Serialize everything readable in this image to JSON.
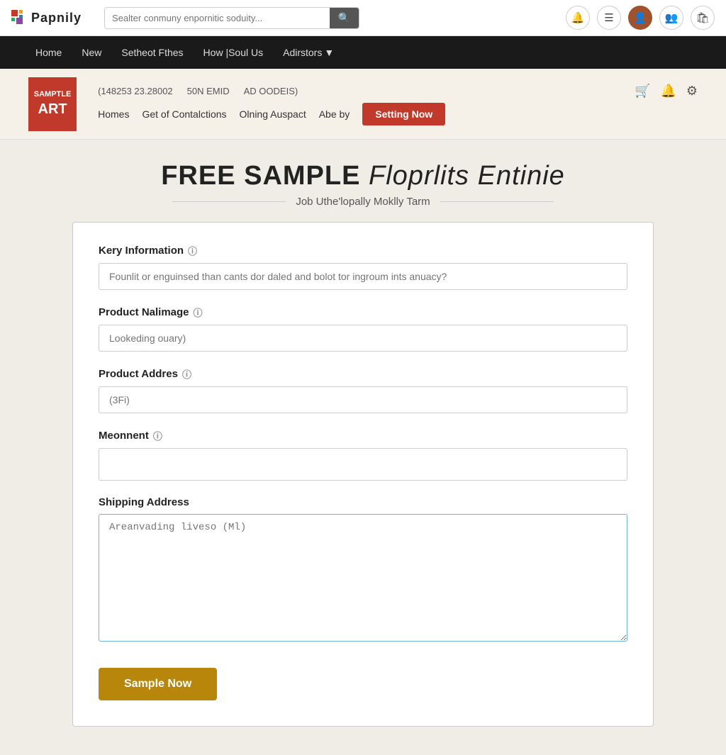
{
  "topbar": {
    "logo_text": "Papnily",
    "search_placeholder": "Sealter conmuny enpornitic soduity...",
    "search_value": ""
  },
  "main_nav": {
    "items": [
      {
        "label": "Home"
      },
      {
        "label": "New"
      },
      {
        "label": "Setheot Fthes"
      },
      {
        "label": "How |Soul Us"
      },
      {
        "label": "Adirstors",
        "dropdown": true
      }
    ]
  },
  "brand_bar": {
    "logo_line1": "SAMPTLE",
    "logo_line2": "ART",
    "contact1": "(148253 23.28002",
    "contact2": "50N EMID",
    "contact3": "AD OODEIS)",
    "sub_nav": [
      {
        "label": "Homes"
      },
      {
        "label": "Get of Contalctions"
      },
      {
        "label": "Olning Auspact"
      },
      {
        "label": "Abe by"
      }
    ],
    "cta_label": "Setting Now"
  },
  "page": {
    "title_bold": "FREE SAMPLE",
    "title_light": "Floprlits Entinie",
    "subtitle": "Job Uthe'lopally Moklly Tarm",
    "form": {
      "key_info_label": "Kery Information",
      "key_info_placeholder": "Founlit or enguinsed than cants dor daled and bolot tor ingroum ints anuacy?",
      "key_info_value": "",
      "product_name_label": "Product Nalimage",
      "product_name_placeholder": "Lookeding ouary)",
      "product_name_value": "",
      "product_address_label": "Product Addres",
      "product_address_placeholder": "(3Fi)",
      "product_address_value": "",
      "meonnent_label": "Meonnent",
      "meonnent_placeholder": "",
      "meonnent_value": "",
      "shipping_label": "Shipping Address",
      "shipping_placeholder": "Areanvading liveso (Ml)",
      "shipping_value": "",
      "submit_label": "Sample Now"
    }
  }
}
